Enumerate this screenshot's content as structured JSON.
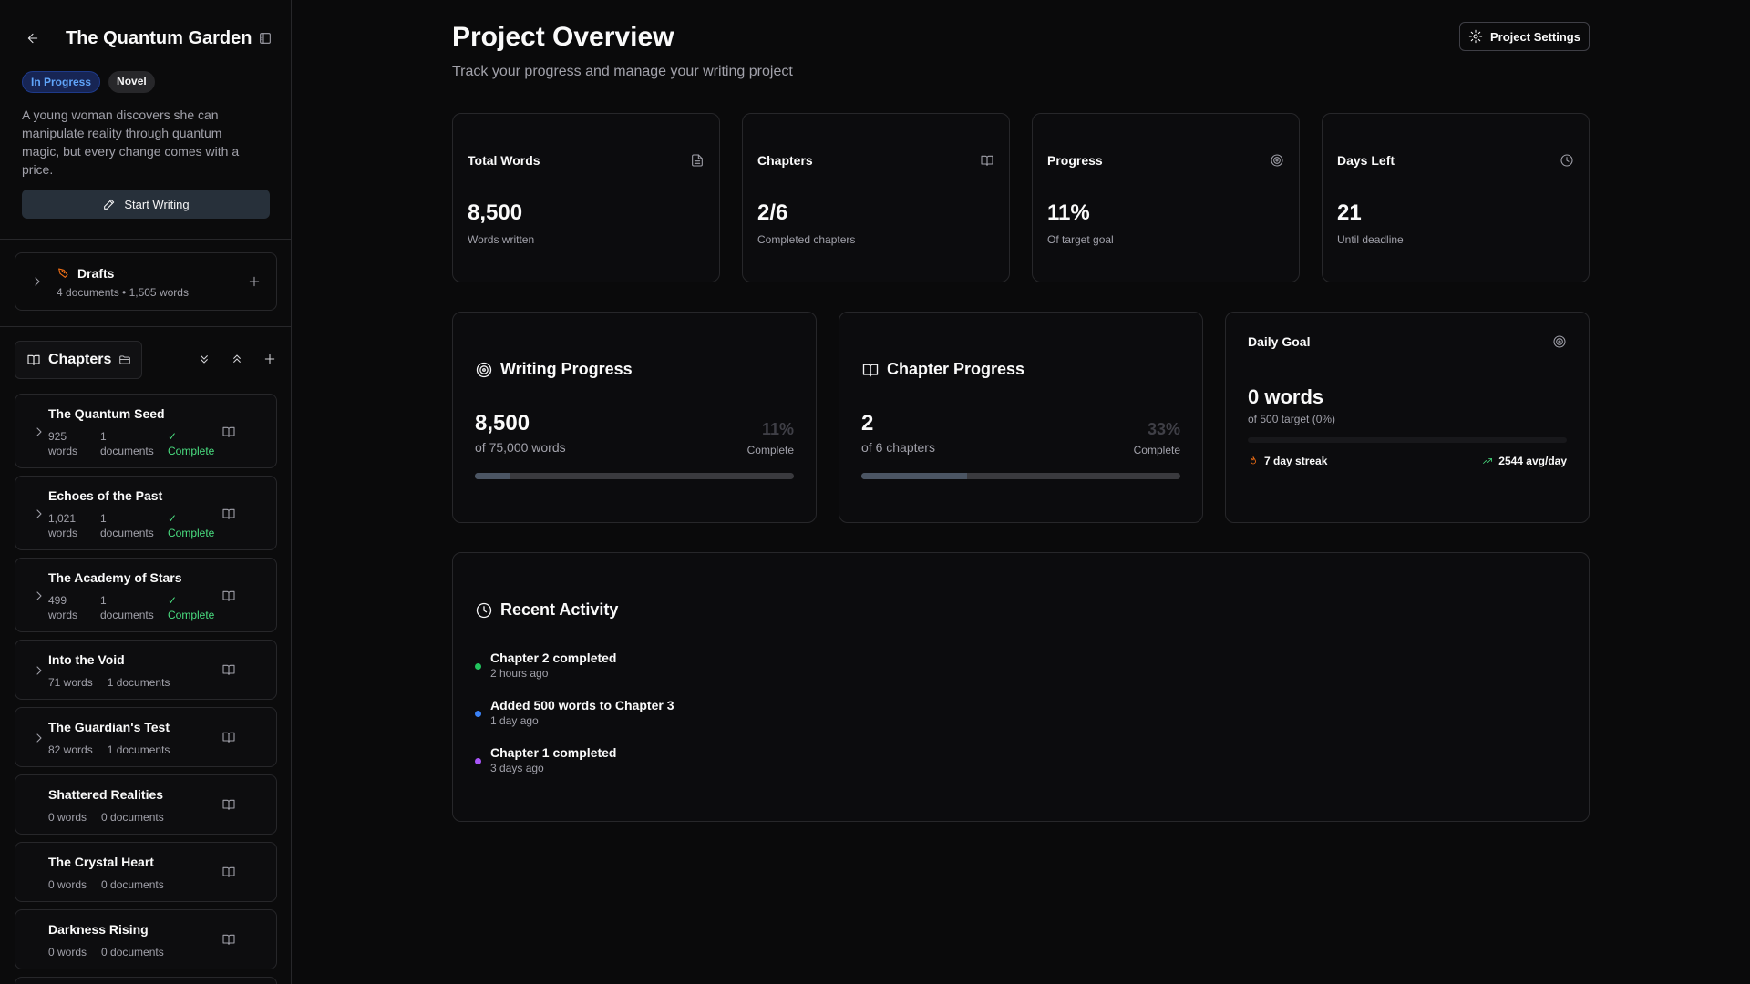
{
  "sidebar": {
    "project_title": "The Quantum Garden",
    "badges": {
      "status": "In Progress",
      "type": "Novel"
    },
    "description": "A young woman discovers she can manipulate reality through quantum magic, but every change comes with a price.",
    "start_writing_label": "Start Writing",
    "drafts": {
      "title": "Drafts",
      "summary": "4 documents • 1,505 words"
    },
    "chapters_label": "Chapters",
    "chapters": [
      {
        "title": "The Quantum Seed",
        "words": "925",
        "words_unit": "words",
        "docs": "1",
        "docs_unit": "documents",
        "status": "Complete"
      },
      {
        "title": "Echoes of the Past",
        "words": "1,021",
        "words_unit": "words",
        "docs": "1",
        "docs_unit": "documents",
        "status": "Complete"
      },
      {
        "title": "The Academy of Stars",
        "words": "499",
        "words_unit": "words",
        "docs": "1",
        "docs_unit": "documents",
        "status": "Complete"
      },
      {
        "title": "Into the Void",
        "words_text": "71 words",
        "docs_text": "1 documents"
      },
      {
        "title": "The Guardian's Test",
        "words_text": "82 words",
        "docs_text": "1 documents"
      },
      {
        "title": "Shattered Realities",
        "words_text": "0 words",
        "docs_text": "0 documents"
      },
      {
        "title": "The Crystal Heart",
        "words_text": "0 words",
        "docs_text": "0 documents"
      },
      {
        "title": "Darkness Rising",
        "words_text": "0 words",
        "docs_text": "0 documents"
      }
    ]
  },
  "main": {
    "title": "Project Overview",
    "subtitle": "Track your progress and manage your writing project",
    "settings_label": "Project Settings",
    "stats": [
      {
        "label": "Total Words",
        "value": "8,500",
        "sub": "Words written",
        "icon": "file-text-icon"
      },
      {
        "label": "Chapters",
        "value": "2/6",
        "sub": "Completed chapters",
        "icon": "book-open-icon"
      },
      {
        "label": "Progress",
        "value": "11%",
        "sub": "Of target goal",
        "icon": "target-icon"
      },
      {
        "label": "Days Left",
        "value": "21",
        "sub": "Until deadline",
        "icon": "clock-icon"
      }
    ],
    "writing_progress": {
      "title": "Writing Progress",
      "value": "8,500",
      "sub": "of 75,000 words",
      "percent": "11%",
      "percent_label": "Complete",
      "fraction": 0.11
    },
    "chapter_progress": {
      "title": "Chapter Progress",
      "value": "2",
      "sub": "of 6 chapters",
      "percent": "33%",
      "percent_label": "Complete",
      "fraction": 0.33
    },
    "daily_goal": {
      "title": "Daily Goal",
      "value": "0 words",
      "sub": "of 500 target (0%)",
      "fraction": 0,
      "streak": "7 day streak",
      "avg": "2544 avg/day"
    },
    "recent_activity": {
      "title": "Recent Activity",
      "items": [
        {
          "text": "Chapter 2 completed",
          "time": "2 hours ago",
          "color": "#22c55e"
        },
        {
          "text": "Added 500 words to Chapter 3",
          "time": "1 day ago",
          "color": "#3b82f6"
        },
        {
          "text": "Chapter 1 completed",
          "time": "3 days ago",
          "color": "#a855f7"
        }
      ]
    }
  },
  "colors": {
    "accent_green": "#4ade80",
    "accent_blue": "#60a5fa",
    "draft_orange": "#f97316"
  }
}
